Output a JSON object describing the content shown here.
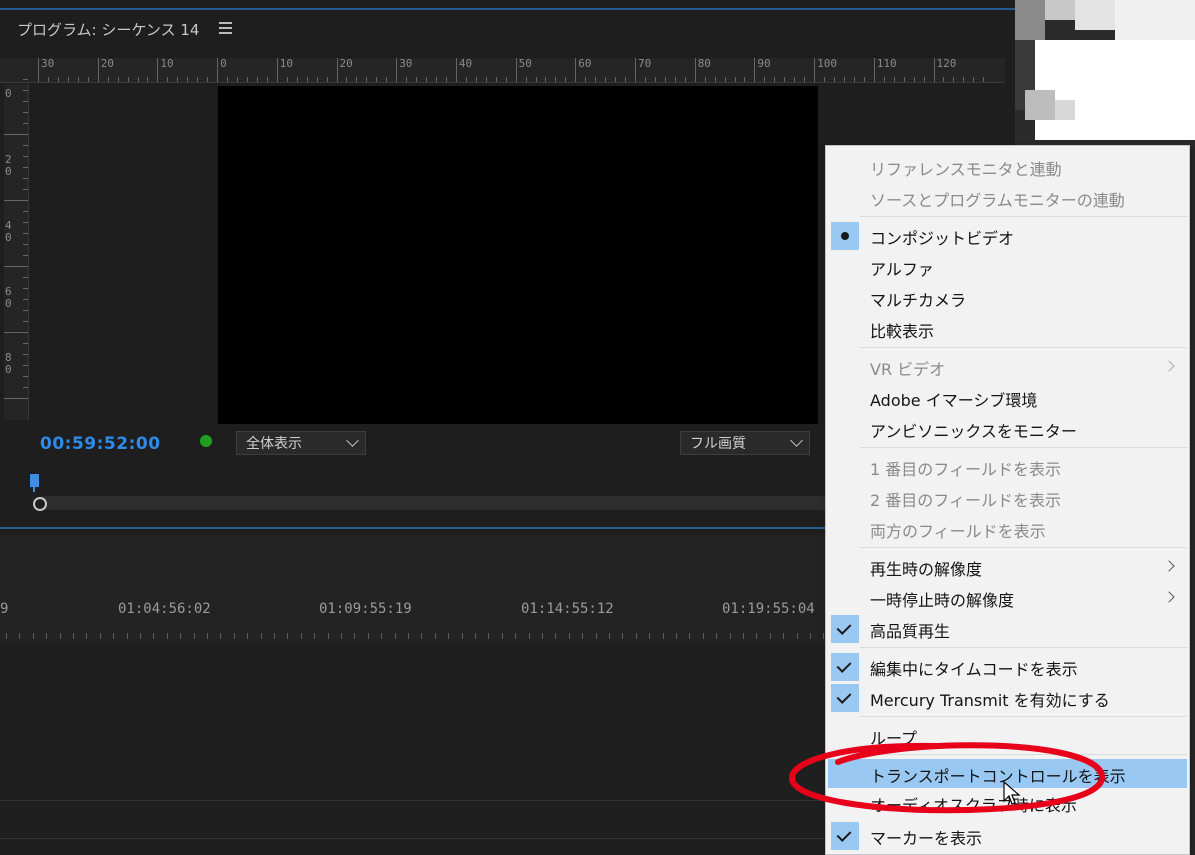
{
  "monitor": {
    "title": "プログラム: シーケンス 14",
    "timecode": "00:59:52:00",
    "zoom_select": "全体表示",
    "quality_select": "フル画質",
    "ruler_h_labels": [
      "30",
      "20",
      "10",
      "0",
      "10",
      "20",
      "30",
      "40",
      "50",
      "60",
      "70",
      "80",
      "90",
      "100",
      "110",
      "120"
    ],
    "ruler_v_labels": [
      [
        "0"
      ],
      [
        "2",
        "0"
      ],
      [
        "4",
        "0"
      ],
      [
        "6",
        "0"
      ],
      [
        "8",
        "0"
      ]
    ]
  },
  "timeline": {
    "labels": [
      "9",
      "01:04:56:02",
      "01:09:55:19",
      "01:14:55:12",
      "01:19:55:04"
    ]
  },
  "menu": {
    "items": [
      {
        "label": "リファレンスモニタと連動",
        "state": "disabled"
      },
      {
        "label": "ソースとプログラムモニターの連動",
        "state": "disabled"
      },
      {
        "label": "コンポジットビデオ",
        "mark": "bullet"
      },
      {
        "label": "アルファ"
      },
      {
        "label": "マルチカメラ"
      },
      {
        "label": "比較表示"
      },
      {
        "label": "VR ビデオ",
        "state": "disabled",
        "submenu": true
      },
      {
        "label": "Adobe イマーシブ環境"
      },
      {
        "label": "アンビソニックスをモニター"
      },
      {
        "label": "1 番目のフィールドを表示",
        "state": "disabled"
      },
      {
        "label": "2 番目のフィールドを表示",
        "state": "disabled"
      },
      {
        "label": "両方のフィールドを表示",
        "state": "disabled"
      },
      {
        "label": "再生時の解像度",
        "submenu": true
      },
      {
        "label": "一時停止時の解像度",
        "submenu": true
      },
      {
        "label": "高品質再生",
        "mark": "check"
      },
      {
        "label": "編集中にタイムコードを表示",
        "mark": "check"
      },
      {
        "label": "Mercury Transmit を有効にする",
        "mark": "check"
      },
      {
        "label": "ループ"
      },
      {
        "label": "トランスポートコントロールを表示",
        "state": "highlighted"
      },
      {
        "label": "オーディオスクラブ時に表示"
      },
      {
        "label": "マーカーを表示",
        "mark": "check"
      }
    ]
  },
  "colors": {
    "accent": "#2d8ceb",
    "highlight": "#99c9f2",
    "annotation": "#e8001a",
    "status_dot": "#1ea01e"
  }
}
